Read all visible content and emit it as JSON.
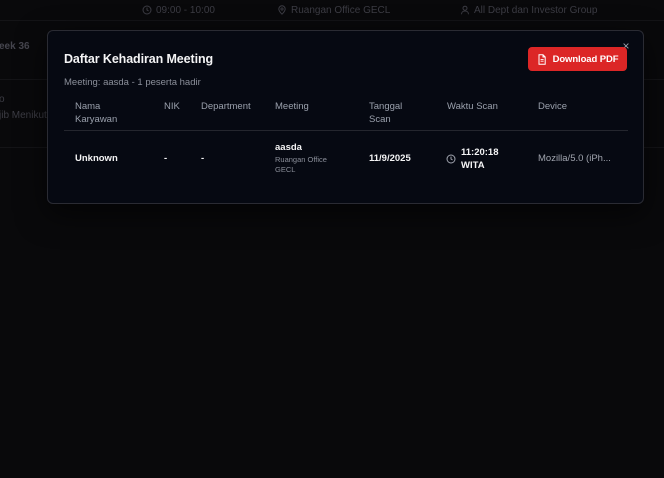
{
  "background": {
    "row1": {
      "time": "09:00 - 10:00",
      "location": "Ruangan Office GECL",
      "audience": "All Dept dan Investor Group"
    },
    "row2": {
      "title_fragment": "eek 36"
    },
    "row3": {
      "text_fragment": "jib Menikut"
    }
  },
  "modal": {
    "title": "Daftar Kehadiran Meeting",
    "subtitle": "Meeting: aasda - 1 peserta hadir",
    "close_label": "×",
    "download_label": "Download PDF"
  },
  "table": {
    "headers": {
      "nama_1": "Nama",
      "nama_2": "Karyawan",
      "nik": "NIK",
      "department": "Department",
      "meeting": "Meeting",
      "tanggal_1": "Tanggal",
      "tanggal_2": "Scan",
      "waktu": "Waktu Scan",
      "device": "Device"
    },
    "rows": [
      {
        "nama": "Unknown",
        "nik": "-",
        "department": "-",
        "meeting_name": "aasda",
        "meeting_loc_1": "Ruangan Office",
        "meeting_loc_2": "GECL",
        "tanggal": "11/9/2025",
        "waktu_1": "11:20:18",
        "waktu_2": "WITA",
        "device": "Mozilla/5.0 (iPh..."
      }
    ]
  },
  "colors": {
    "accent": "#dc2626",
    "modal_bg": "#060912",
    "page_bg": "#09090b"
  }
}
